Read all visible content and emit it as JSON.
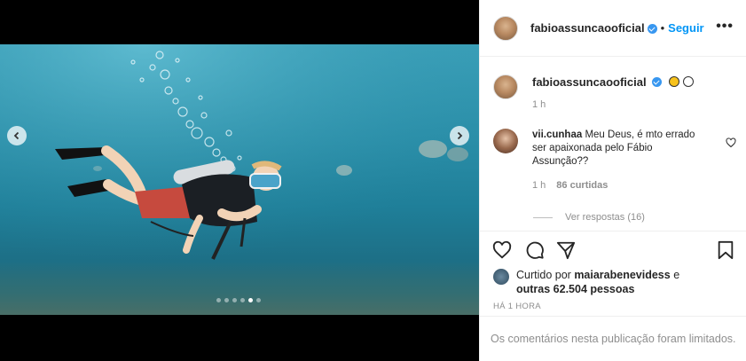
{
  "post": {
    "username": "fabioassuncaooficial",
    "separator": "•",
    "follow_label": "Seguir",
    "more_label": "•••"
  },
  "caption": {
    "username": "fabioassuncaooficial",
    "time": "1 h"
  },
  "comment": {
    "username": "vii.cunhaa",
    "text": "Meu Deus, é mto errado ser apaixonada pelo Fábio Assunção??",
    "time": "1 h",
    "likes": "86 curtidas",
    "replies_label": "Ver respostas (16)"
  },
  "likes": {
    "prefix": "Curtido por ",
    "user": "maiarabenevidess",
    "middle": " e",
    "others": "outras 62.504 pessoas"
  },
  "timestamp": "HÁ 1 HORA",
  "comments_limited": "Os comentários nesta publicação foram limitados.",
  "carousel": {
    "total": 6,
    "active_index": 4
  },
  "colors": {
    "accent": "#0095f6",
    "verified": "#3897f0",
    "water": "#2a8ea8"
  }
}
